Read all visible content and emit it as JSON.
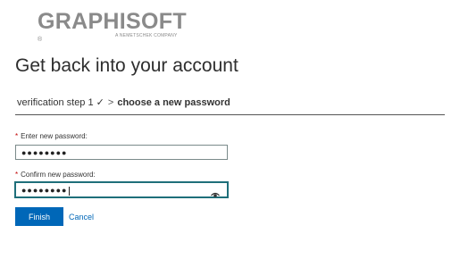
{
  "brand": {
    "name": "GRAPHISOFT",
    "mark": "®",
    "tagline": "A NEMETSCHEK COMPANY"
  },
  "page": {
    "title": "Get back into your account"
  },
  "steps": {
    "done": "verification step 1",
    "check": "✓",
    "separator": ">",
    "current": "choose a new password"
  },
  "form": {
    "required_mark": "*",
    "new_password": {
      "label": "Enter new password:",
      "value_masked": "●●●●●●●●"
    },
    "confirm_password": {
      "label": "Confirm new password:",
      "value_masked": "●●●●●●●●",
      "reveal_icon": "eye-icon"
    }
  },
  "actions": {
    "finish_label": "Finish",
    "cancel_label": "Cancel"
  },
  "colors": {
    "accent": "#0067b8",
    "focus": "#1f6f7a",
    "required": "#c00000",
    "logo": "#8a8a8a"
  }
}
